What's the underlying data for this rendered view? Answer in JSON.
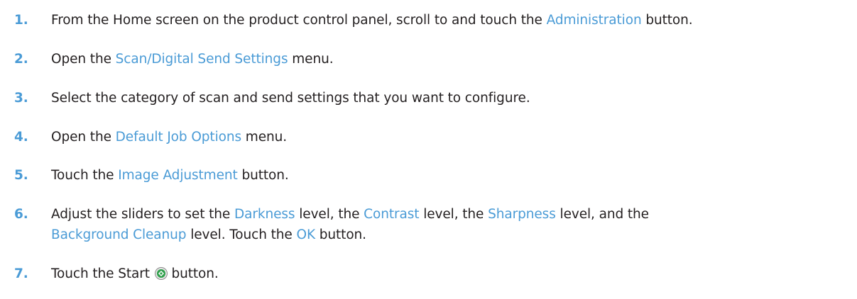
{
  "steps": [
    {
      "number": "1.",
      "parts": [
        {
          "text": "From the Home screen on the product control panel, scroll to and touch the ",
          "link": false
        },
        {
          "text": "Administration",
          "link": true
        },
        {
          "text": " button.",
          "link": false
        }
      ]
    },
    {
      "number": "2.",
      "parts": [
        {
          "text": "Open the ",
          "link": false
        },
        {
          "text": "Scan/Digital Send Settings",
          "link": true
        },
        {
          "text": " menu.",
          "link": false
        }
      ]
    },
    {
      "number": "3.",
      "parts": [
        {
          "text": "Select the category of scan and send settings that you want to configure.",
          "link": false
        }
      ]
    },
    {
      "number": "4.",
      "parts": [
        {
          "text": "Open the ",
          "link": false
        },
        {
          "text": "Default Job Options",
          "link": true
        },
        {
          "text": " menu.",
          "link": false
        }
      ]
    },
    {
      "number": "5.",
      "parts": [
        {
          "text": "Touch the ",
          "link": false
        },
        {
          "text": "Image Adjustment",
          "link": true
        },
        {
          "text": " button.",
          "link": false
        }
      ]
    },
    {
      "number": "6.",
      "parts": [
        {
          "text": "Adjust the sliders to set the ",
          "link": false
        },
        {
          "text": "Darkness",
          "link": true
        },
        {
          "text": " level, the ",
          "link": false
        },
        {
          "text": "Contrast",
          "link": true
        },
        {
          "text": " level, the ",
          "link": false
        },
        {
          "text": "Sharpness",
          "link": true
        },
        {
          "text": " level, and the",
          "link": false
        },
        {
          "br": true
        },
        {
          "text": "Background Cleanup",
          "link": true
        },
        {
          "text": " level. Touch the ",
          "link": false
        },
        {
          "text": "OK",
          "link": true
        },
        {
          "text": " button.",
          "link": false
        }
      ]
    },
    {
      "number": "7.",
      "parts": [
        {
          "text": "Touch the Start ",
          "link": false
        },
        {
          "icon": "start-icon"
        },
        {
          "text": " button.",
          "link": false
        }
      ]
    }
  ],
  "colors": {
    "accent": "#4a9bd6",
    "text": "#231f20",
    "start_icon_green": "#2e9e4a"
  }
}
